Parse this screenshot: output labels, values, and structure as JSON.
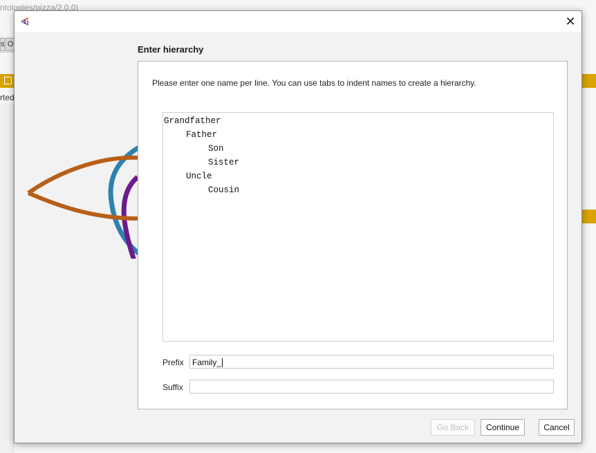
{
  "background": {
    "window_title_fragment": "ntologies/pizza/2.0.0)",
    "tab_fragment_1": "s",
    "tab_fragment_2": "O",
    "started_fragment": "rted"
  },
  "dialog": {
    "app_icon": "protege-logo-icon",
    "close_icon": "close-icon",
    "close_label": "✕",
    "section_title": "Enter hierarchy",
    "instructions": "Please enter one name per line. You can use tabs to indent names to create a hierarchy.",
    "hierarchy_lines": [
      {
        "text": "Grandfather",
        "indent": 0
      },
      {
        "text": "Father",
        "indent": 1
      },
      {
        "text": "Son",
        "indent": 2
      },
      {
        "text": "Sister",
        "indent": 2
      },
      {
        "text": "Uncle",
        "indent": 1
      },
      {
        "text": "Cousin",
        "indent": 2
      }
    ],
    "prefix_label": "Prefix",
    "prefix_value": "Family_",
    "suffix_label": "Suffix",
    "suffix_value": "",
    "buttons": {
      "go_back": "Go Back",
      "continue": "Continue",
      "cancel": "Cancel"
    }
  },
  "colors": {
    "accent_gold": "#d9a300",
    "art_orange": "#b85f18",
    "art_blue": "#2e82b0",
    "art_purple": "#6c1b8c"
  }
}
